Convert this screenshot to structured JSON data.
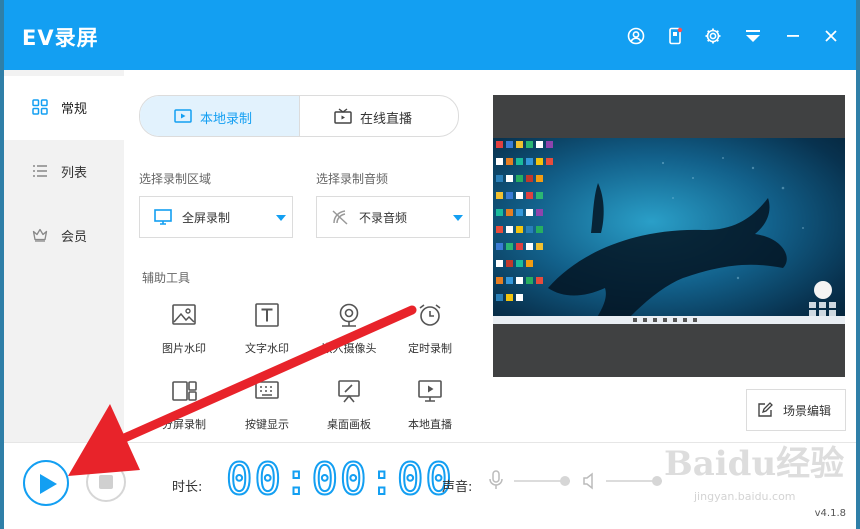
{
  "app": {
    "title": "EV录屏",
    "version": "v4.1.8"
  },
  "sidebar": {
    "items": [
      {
        "label": "常规",
        "icon": "grid-icon",
        "active": true
      },
      {
        "label": "列表",
        "icon": "list-icon",
        "active": false
      },
      {
        "label": "会员",
        "icon": "crown-icon",
        "active": false
      }
    ]
  },
  "tabs": [
    {
      "label": "本地录制",
      "icon": "video-icon",
      "active": true
    },
    {
      "label": "在线直播",
      "icon": "tv-icon",
      "active": false
    }
  ],
  "record_area": {
    "label": "选择录制区域",
    "value": "全屏录制",
    "icon": "monitor-icon"
  },
  "record_audio": {
    "label": "选择录制音频",
    "value": "不录音频",
    "icon": "no-audio-icon"
  },
  "tools": {
    "label": "辅助工具",
    "items": [
      {
        "label": "图片水印",
        "icon": "image-icon"
      },
      {
        "label": "文字水印",
        "icon": "text-icon"
      },
      {
        "label": "嵌入摄像头",
        "icon": "camera-icon"
      },
      {
        "label": "定时录制",
        "icon": "alarm-icon"
      },
      {
        "label": "分屏录制",
        "icon": "split-screen-icon"
      },
      {
        "label": "按键显示",
        "icon": "keyboard-icon"
      },
      {
        "label": "桌面画板",
        "icon": "easel-icon"
      },
      {
        "label": "本地直播",
        "icon": "play-screen-icon"
      }
    ]
  },
  "scene_edit": {
    "label": "场景编辑"
  },
  "bottom": {
    "duration_label": "时长:",
    "timer": "00:00:00",
    "sound_label": "声音:"
  },
  "watermark": {
    "text": "Baidu经验",
    "url": "jingyan.baidu.com"
  },
  "colors": {
    "accent": "#139ff2",
    "annotation_arrow": "#e8232a"
  }
}
